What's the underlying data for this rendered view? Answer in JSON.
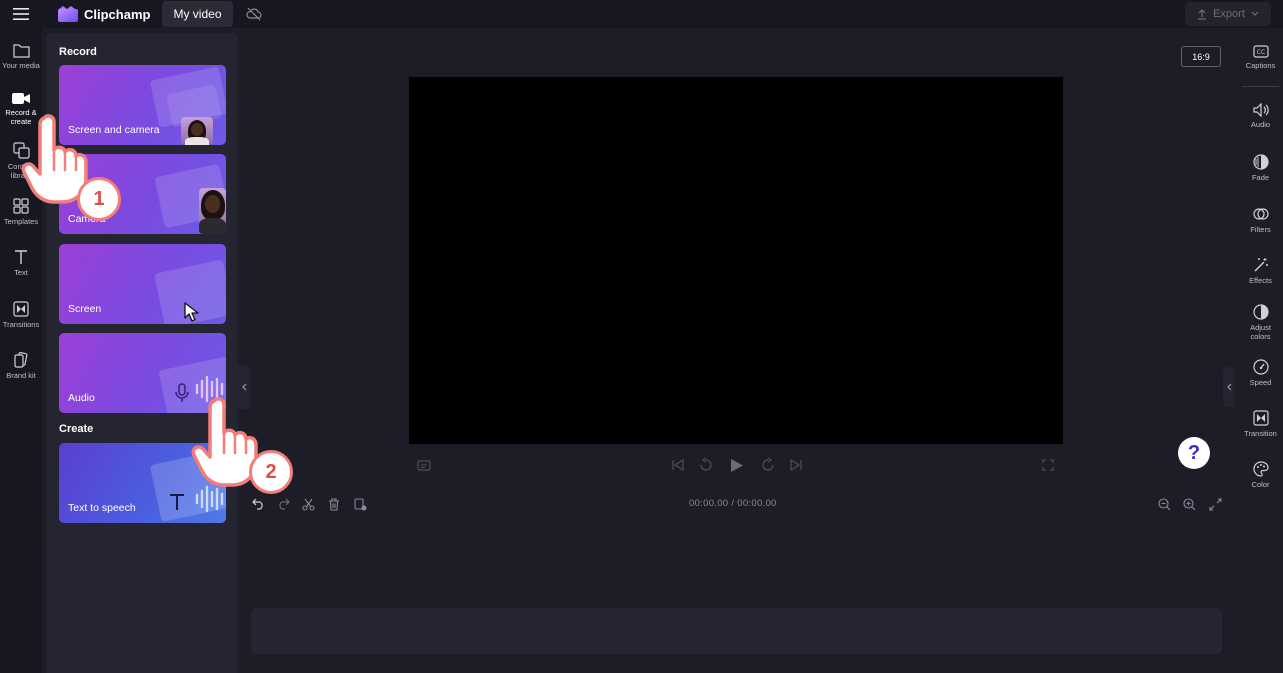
{
  "topbar": {
    "brand": "Clipchamp",
    "project_title": "My video",
    "export_label": "Export"
  },
  "left_rail": [
    {
      "label": "Your media",
      "icon": "folder-icon"
    },
    {
      "label": "Record & create",
      "icon": "video-camera-icon",
      "active": true
    },
    {
      "label": "Content library",
      "icon": "content-library-icon"
    },
    {
      "label": "Templates",
      "icon": "templates-icon"
    },
    {
      "label": "Text",
      "icon": "text-icon"
    },
    {
      "label": "Transitions",
      "icon": "transitions-icon"
    },
    {
      "label": "Brand kit",
      "icon": "brand-kit-icon"
    }
  ],
  "panel": {
    "record_title": "Record",
    "create_title": "Create",
    "cards": [
      {
        "label": "Screen and camera"
      },
      {
        "label": "Camera"
      },
      {
        "label": "Screen"
      },
      {
        "label": "Audio"
      },
      {
        "label": "Text to speech"
      }
    ]
  },
  "preview": {
    "aspect_ratio": "16:9"
  },
  "right_rail": [
    {
      "label": "Captions",
      "icon": "captions-icon"
    },
    {
      "label": "Audio",
      "icon": "speaker-icon"
    },
    {
      "label": "Fade",
      "icon": "fade-icon"
    },
    {
      "label": "Filters",
      "icon": "filters-icon"
    },
    {
      "label": "Effects",
      "icon": "magic-wand-icon"
    },
    {
      "label": "Adjust colors",
      "icon": "adjust-colors-icon"
    },
    {
      "label": "Speed",
      "icon": "speedometer-icon"
    },
    {
      "label": "Transition",
      "icon": "transition-icon"
    },
    {
      "label": "Color",
      "icon": "palette-icon"
    }
  ],
  "timeline": {
    "current_time": "00:00.00",
    "separator": "/",
    "total_time": "00:00.00"
  },
  "help": {
    "label": "?"
  },
  "annotations": {
    "step1": "1",
    "step2": "2"
  },
  "colors": {
    "background": "#1d1d28",
    "panel": "#252532",
    "card_gradient_start": "#9b3fd6",
    "card_gradient_end": "#6d5ae6",
    "badge_border": "#f37d79",
    "badge_text": "#e44d46",
    "help_text": "#3b2fc0"
  }
}
